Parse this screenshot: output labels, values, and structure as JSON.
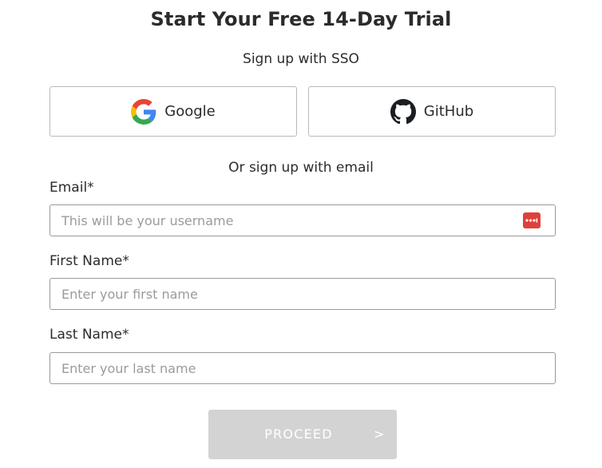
{
  "header": {
    "title": "Start Your Free 14-Day Trial",
    "sso_label": "Sign up with SSO"
  },
  "sso": {
    "google": {
      "label": "Google",
      "icon": "google-icon"
    },
    "github": {
      "label": "GitHub",
      "icon": "github-icon"
    }
  },
  "divider": {
    "label": "Or sign up with email"
  },
  "form": {
    "email": {
      "label": "Email*",
      "placeholder": "This will be your username",
      "value": ""
    },
    "first_name": {
      "label": "First Name*",
      "placeholder": "Enter your first name",
      "value": ""
    },
    "last_name": {
      "label": "Last Name*",
      "placeholder": "Enter your last name",
      "value": ""
    },
    "password_manager_icon": "password-manager-icon"
  },
  "actions": {
    "proceed_label": "PROCEED",
    "proceed_arrow": ">"
  },
  "colors": {
    "button_disabled": "#d3d3d3",
    "password_manager": "#e0403a",
    "google_blue": "#4285F4",
    "google_red": "#EA4335",
    "google_yellow": "#FBBC05",
    "google_green": "#34A853"
  }
}
